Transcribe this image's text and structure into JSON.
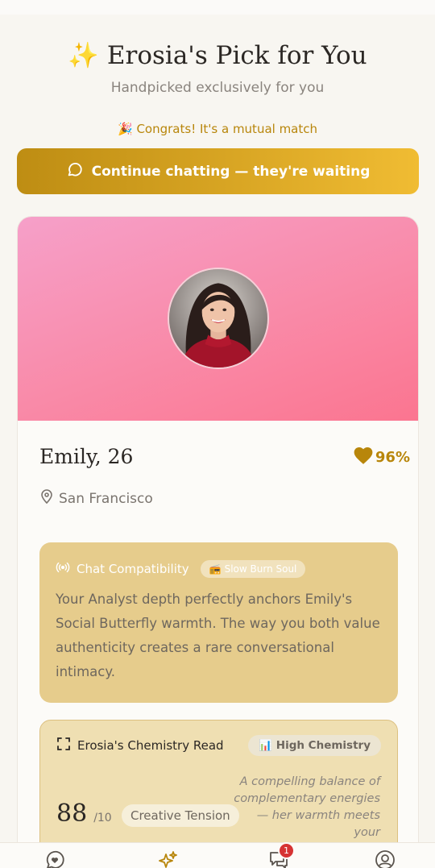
{
  "header": {
    "title_icon": "✨",
    "title": "Erosia's Pick for You",
    "subtitle": "Handpicked exclusively for you",
    "congrats_icon": "🎉",
    "congrats": "Congrats! It's a mutual match"
  },
  "cta": {
    "label": "Continue chatting — they're waiting"
  },
  "profile": {
    "name_age": "Emily, 26",
    "match_percent": "96%",
    "location": "San Francisco",
    "hero_colors": [
      "#f6a0c9",
      "#fb7590"
    ]
  },
  "compatibility": {
    "title": "Chat Compatibility",
    "tag_icon": "📻",
    "tag": "Slow Burn Soul",
    "text": "Your Analyst depth perfectly anchors Emily's Social Butterfly warmth. The way you both value authenticity creates a rare conversational intimacy."
  },
  "chemistry": {
    "title": "Erosia's Chemistry Read",
    "badge_icon": "📊",
    "badge": "High Chemistry",
    "score": "88",
    "score_denominator": "/10",
    "label": "Creative Tension",
    "description": "A compelling balance of complementary energies — her warmth meets your"
  },
  "nav": {
    "items": [
      "chat-heart-icon",
      "sparkles-icon",
      "messages-icon",
      "profile-icon"
    ],
    "active": "sparkles-icon",
    "messages_badge": "1"
  },
  "colors": {
    "accent": "#b8860b",
    "background": "#f8f6f1",
    "compat_bg": "#e6cc8c",
    "chem_bg": "#efdfb2"
  }
}
